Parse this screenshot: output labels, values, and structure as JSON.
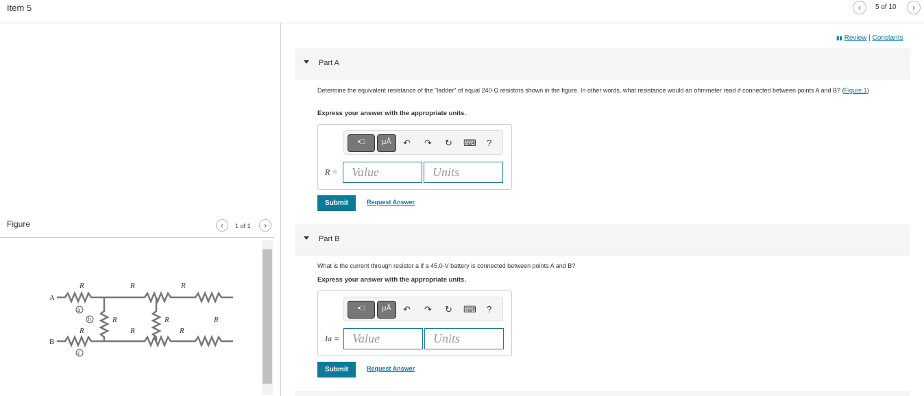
{
  "header": {
    "item": "Item 5",
    "pager": "5 of 10"
  },
  "links": {
    "review": "Review",
    "sep": "|",
    "constants": "Constants"
  },
  "figure": {
    "title": "Figure",
    "pager": "1 of 1",
    "labels": {
      "A": "A",
      "B": "B",
      "R": "R",
      "a": "a",
      "b": "b",
      "c": "c"
    }
  },
  "partA": {
    "label": "Part A",
    "question": "Determine the equivalent resistance of the \"ladder\" of equal 240-Ω resistors shown in the figure. In other words, what resistance would an ohmmeter read if connected between points A and B?",
    "figure_link": "Figure 1",
    "instruction": "Express your answer with the appropriate units.",
    "var": "R =",
    "value_placeholder": "Value",
    "units_placeholder": "Units",
    "submit": "Submit",
    "request": "Request Answer"
  },
  "partB": {
    "label": "Part B",
    "question": "What is the current through resistor a if a 45.0-V battery is connected between points A and B?",
    "instruction": "Express your answer with the appropriate units.",
    "var": "Ia =",
    "value_placeholder": "Value",
    "units_placeholder": "Units",
    "submit": "Submit",
    "request": "Request Answer"
  },
  "toolbar": {
    "templates": "▪□",
    "units": "μÅ",
    "undo": "↶",
    "redo": "↷",
    "reset": "↻",
    "keyboard": "⌨",
    "help": "?"
  }
}
